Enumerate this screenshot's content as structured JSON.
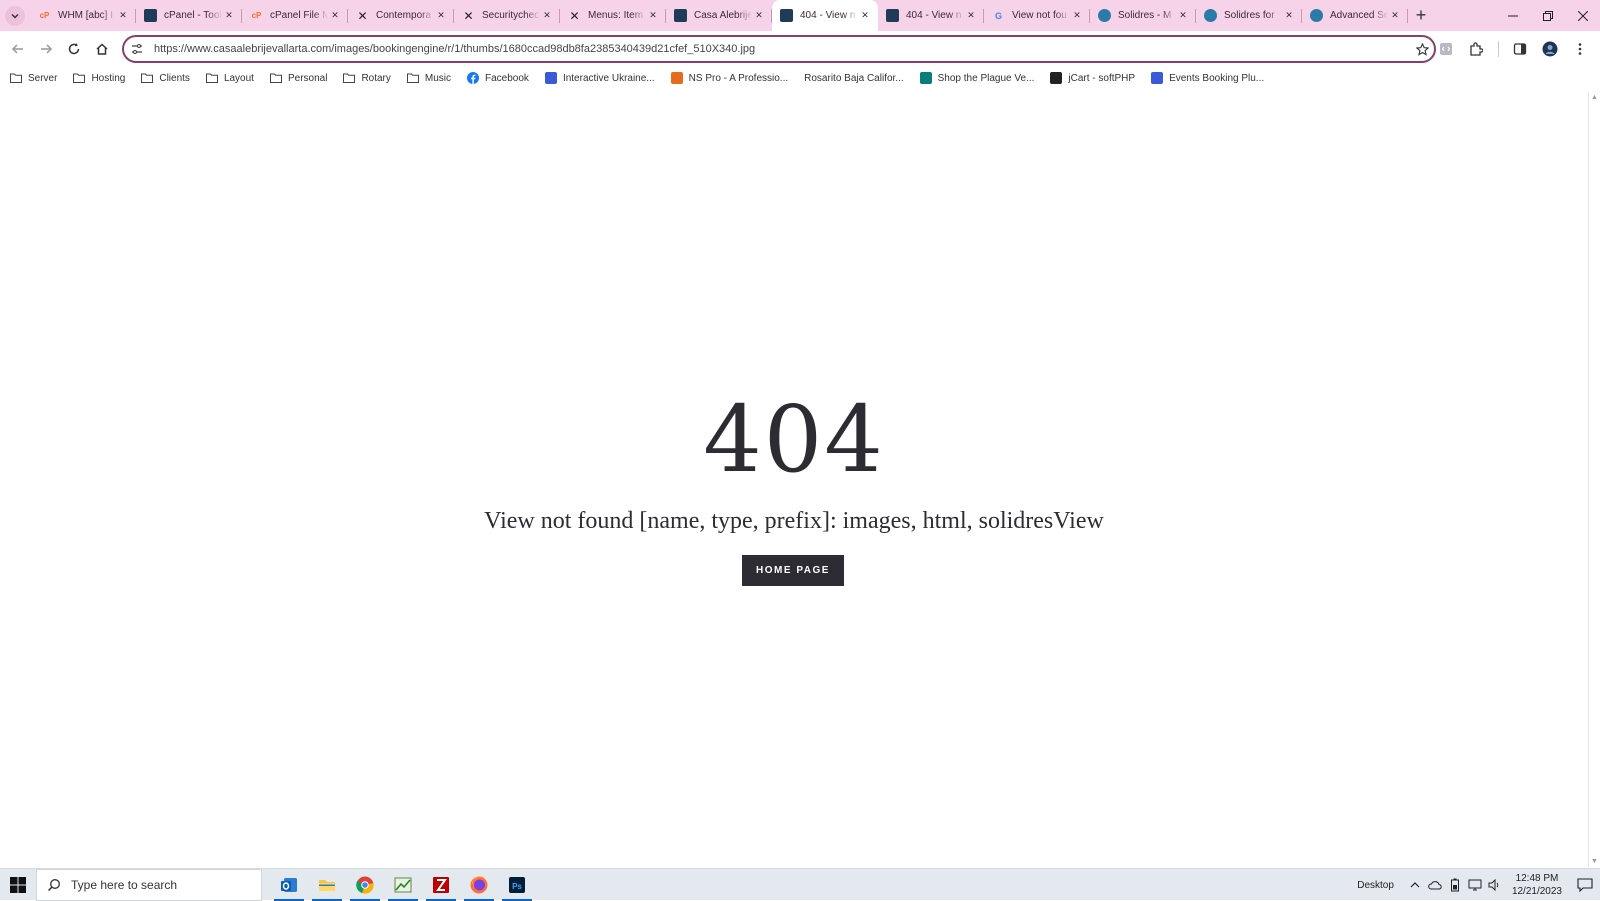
{
  "browser": {
    "tabs": [
      {
        "title": "WHM [abc] I",
        "icon": "cpanel-icon",
        "color": "#ff6c2c"
      },
      {
        "title": "cPanel - Tools",
        "icon": "joomla-dark-icon",
        "color": "#1f3b57"
      },
      {
        "title": "cPanel File M",
        "icon": "cpanel-icon",
        "color": "#ff6c2c"
      },
      {
        "title": "Contempora",
        "icon": "joomla-x-icon",
        "color": "#222222"
      },
      {
        "title": "Securitychec",
        "icon": "joomla-x-icon",
        "color": "#222222"
      },
      {
        "title": "Menus: Item",
        "icon": "joomla-x-icon",
        "color": "#222222"
      },
      {
        "title": "Casa Alebrije",
        "icon": "site-icon",
        "color": "#1f3b57"
      },
      {
        "title": "404 - View n",
        "icon": "site-icon",
        "color": "#1f3b57",
        "active": true
      },
      {
        "title": "404 - View n",
        "icon": "site-icon",
        "color": "#1f3b57"
      },
      {
        "title": "View not fou",
        "icon": "google-icon",
        "color": "#4285f4"
      },
      {
        "title": "Solidres - M",
        "icon": "solidres-icon",
        "color": "#2b7aa8"
      },
      {
        "title": "Solidres for",
        "icon": "solidres-icon",
        "color": "#2b7aa8"
      },
      {
        "title": "Advanced Se",
        "icon": "solidres-icon",
        "color": "#2b7aa8"
      }
    ],
    "url": "https://www.casaalebrijevallarta.com/images/bookingengine/r/1/thumbs/1680ccad98db8fa2385340439d21cfef_510X340.jpg",
    "bookmarks": [
      {
        "label": "Server",
        "icon": "folder-icon"
      },
      {
        "label": "Hosting",
        "icon": "folder-icon"
      },
      {
        "label": "Clients",
        "icon": "folder-icon"
      },
      {
        "label": "Layout",
        "icon": "folder-icon"
      },
      {
        "label": "Personal",
        "icon": "folder-icon"
      },
      {
        "label": "Rotary",
        "icon": "folder-icon"
      },
      {
        "label": "Music",
        "icon": "folder-icon"
      },
      {
        "label": "Facebook",
        "icon": "facebook-icon"
      },
      {
        "label": "Interactive Ukraine...",
        "icon": "site-icon"
      },
      {
        "label": "NS Pro - A Professio...",
        "icon": "site-icon"
      },
      {
        "label": "Rosarito Baja Califor...",
        "icon": "blank-icon"
      },
      {
        "label": "Shop the Plague Ve...",
        "icon": "site-icon"
      },
      {
        "label": "jCart - softPHP",
        "icon": "site-icon"
      },
      {
        "label": "Events Booking Plu...",
        "icon": "site-icon"
      }
    ]
  },
  "page": {
    "code": "404",
    "message": "View not found [name, type, prefix]: images, html, solidresView",
    "button": "HOME PAGE"
  },
  "taskbar": {
    "search_placeholder": "Type here to search",
    "desktop_label": "Desktop",
    "time": "12:48 PM",
    "date": "12/21/2023"
  },
  "colors": {
    "tabbar_bg": "#f6d3e9",
    "omnibox_border": "#8a3d6f",
    "button_bg": "#2d2c34",
    "text_dark": "#2c2c32"
  }
}
